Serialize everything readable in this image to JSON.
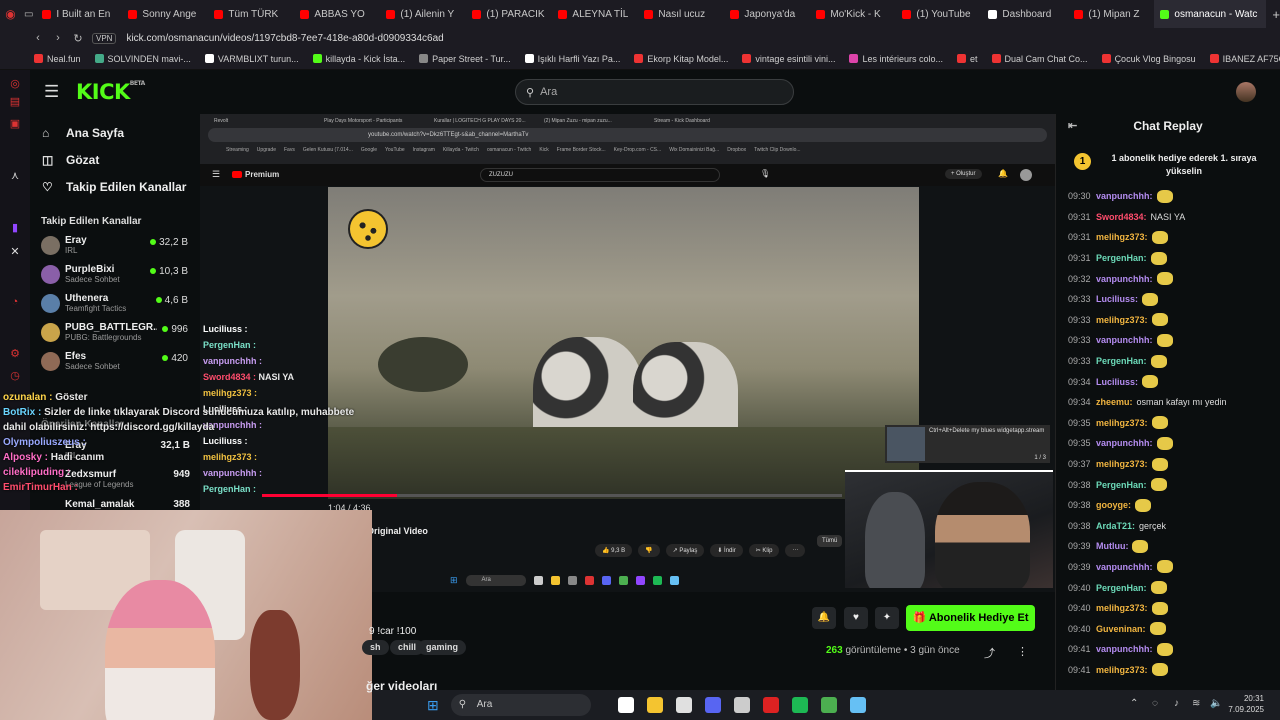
{
  "browser": {
    "tabs": [
      {
        "title": "I Built an En",
        "color": "#ff0000"
      },
      {
        "title": "Sonny Ange",
        "color": "#ff0000"
      },
      {
        "title": "Tüm TÜRK",
        "color": "#ff0000"
      },
      {
        "title": "ABBAS YO",
        "color": "#ff0000"
      },
      {
        "title": "(1) Ailenin Y",
        "color": "#ff0000"
      },
      {
        "title": "(1) PARACIK",
        "color": "#ff0000"
      },
      {
        "title": "ALEYNA TİL",
        "color": "#ff0000"
      },
      {
        "title": "Nasıl ucuz",
        "color": "#ff0000"
      },
      {
        "title": "Japonya'da",
        "color": "#ff0000"
      },
      {
        "title": "Mo'Kick - K",
        "color": "#ff0000"
      },
      {
        "title": "(1) YouTube",
        "color": "#ff0000"
      },
      {
        "title": "Dashboard",
        "color": "#ffffff"
      },
      {
        "title": "(1) Mipan Z",
        "color": "#ff0000"
      },
      {
        "title": "osmanacun - Watc",
        "color": "#53fc18"
      }
    ],
    "url": "kick.com/osmanacun/videos/1197cbd8-7ee7-418e-a80d-d0909334c6ad",
    "vpn_label": "VPN",
    "bookmarks": [
      "Neal.fun",
      "SOLVINDEN mavi-...",
      "VARMBLIXT turun...",
      "killayda - Kick İsta...",
      "Paper Street - Tur...",
      "Işıklı Harfli Yazı Pa...",
      "Ekorp Kitap Model...",
      "vintage esintili vini...",
      "Les intérieurs colo...",
      "et",
      "Dual Cam Chat Co...",
      "Çocuk Vlog Bingosu",
      "IBANEZ AF75G-B..."
    ]
  },
  "kick": {
    "logo": "KICK",
    "logo_badge": "BETA",
    "search_placeholder": "Ara",
    "nav": [
      {
        "label": "Ana Sayfa",
        "icon": "home-icon"
      },
      {
        "label": "Gözat",
        "icon": "browse-icon"
      },
      {
        "label": "Takip Edilen Kanallar",
        "icon": "heart-icon"
      }
    ],
    "followed_title": "Takip Edilen Kanallar",
    "channels": [
      {
        "name": "Eray",
        "category": "IRL",
        "viewers": "32,2 B",
        "color": "#7a6f63"
      },
      {
        "name": "PurpleBixi",
        "category": "Sadece Sohbet",
        "viewers": "10,3 B",
        "color": "#8a5fa8"
      },
      {
        "name": "Uthenera",
        "category": "Teamfight Tactics",
        "viewers": "4,6 B",
        "color": "#5a7fa8"
      },
      {
        "name": "PUBG_BATTLEGR...",
        "category": "PUBG: Battlegrounds",
        "viewers": "996",
        "color": "#c9a44a"
      },
      {
        "name": "Efes",
        "category": "Sadece Sohbet",
        "viewers": "420",
        "color": "#8f6a56"
      }
    ]
  },
  "stream": {
    "inner_tabs": [
      "Revolt",
      "Play Days Motorsport - Participants",
      "Kurallar | LOGITECH G PLAY DAYS 20...",
      "(2) Mipan Zuzu - mipan zuzu...",
      "Stream - Kick Dashboard"
    ],
    "inner_url": "youtube.com/watch?v=Dkz6TTEgt-s&ab_channel=MarthaTv",
    "inner_bookmarks": [
      "Streaming",
      "Upgrade",
      "Favs",
      "Gelen Kutusu (7.014...",
      "Google",
      "YouTube",
      "Instagram",
      "Killayda - Twitch",
      "osmanacun - Twitch",
      "Kick",
      "Frame Border Stock...",
      "Key-Drop.com - CS...",
      "Wix Domaininizi Bağ...",
      "Dropbox",
      "Twitch Clip Downlo..."
    ],
    "yt_logo": "Premium",
    "yt_search": "ZUZUZU",
    "yt_create": "+ Oluştur",
    "timecode": "1:04 / 4:36",
    "progress_fraction": 0.2319,
    "video_title": "Original Video",
    "yt_actions": [
      "👍 9,3 B",
      "👎",
      "↗ Paylaş",
      "⬇ İndir",
      "✂ Klip",
      "···"
    ],
    "tumu": "Tümü",
    "notif_text": "Ctrl+Alt+Delete my blues widgetapp.stream",
    "notif_count": "1 / 3",
    "inner_taskbar_search": "Ara",
    "overlay_chat": [
      {
        "user": "Luciliuss :",
        "color": "#ffffff",
        "msg": ""
      },
      {
        "user": "PergenHan :",
        "color": "#7ae0c8",
        "msg": ""
      },
      {
        "user": "vanpunchhh :",
        "color": "#c79cf0",
        "msg": ""
      },
      {
        "user": "Sword4834 :",
        "color": "#ff4d6d",
        "msg": "NASI YA"
      },
      {
        "user": "melihgz373 :",
        "color": "#f0c040",
        "msg": ""
      },
      {
        "user": "Luciliuss :",
        "color": "#ffffff",
        "msg": ""
      },
      {
        "user": "vanpunchhh :",
        "color": "#c79cf0",
        "msg": ""
      },
      {
        "user": "Luciliuss :",
        "color": "#ffffff",
        "msg": ""
      },
      {
        "user": "melihgz373 :",
        "color": "#f0c040",
        "msg": ""
      },
      {
        "user": "vanpunchhh :",
        "color": "#c79cf0",
        "msg": ""
      },
      {
        "user": "PergenHan :",
        "color": "#7ae0c8",
        "msg": ""
      }
    ]
  },
  "overlay_chat2": [
    {
      "user": "ozunalan :",
      "color": "#ffd54a",
      "msg": "Göster"
    },
    {
      "user": "BotRix :",
      "color": "#6bd5ff",
      "msg": "Sizler de linke tıklayarak Discord sunucumuza katılıp, muhabbete"
    },
    {
      "user": "",
      "color": "#ffffff",
      "msg": "dahil olabilirsiniz: https://discord.gg/killayda"
    },
    {
      "user": "Olympoliuszeus :",
      "color": "#9aa9ff",
      "msg": ""
    },
    {
      "user": "Alposky :",
      "color": "#ff6ec7",
      "msg": "Hadi canım"
    },
    {
      "user": "cileklipuding :",
      "color": "#ff6ec7",
      "msg": ""
    },
    {
      "user": "EmirTimurHan :",
      "color": "#ff4d6d",
      "msg": ""
    }
  ],
  "sidebar_partial": {
    "recommended": "Önerilen Kanallar",
    "ch1": {
      "name": "Eray",
      "cat": "IRL",
      "viewers": "32,1 B"
    },
    "ch2": {
      "name": "Zedxsmurf",
      "cat": "League of Legends",
      "viewers": "949"
    },
    "ch3": {
      "name": "Kemal_amalak",
      "viewers": "388"
    }
  },
  "below": {
    "title_fragment": "9 !car !100",
    "tags": [
      "sh",
      "chill",
      "gaming"
    ],
    "sub_gift_button": "Abonelik Hediye Et",
    "viewers": "263",
    "viewers_label": "görüntüleme",
    "sep": "•",
    "age": "3 gün önce",
    "more_videos": "ğer videoları"
  },
  "chat": {
    "title": "Chat Replay",
    "banner_badge": "1",
    "banner": "1 abonelik hediye ederek 1. sıraya yükselin",
    "messages": [
      {
        "time": "09:30",
        "user": "vanpunchhh:",
        "color": "#b48cf0",
        "msg": "",
        "emote": true
      },
      {
        "time": "09:31",
        "user": "Sword4834:",
        "color": "#ff4d6d",
        "msg": "NASI YA",
        "emote": false
      },
      {
        "time": "09:31",
        "user": "melihgz373:",
        "color": "#f0b440",
        "msg": "",
        "emote": true
      },
      {
        "time": "09:31",
        "user": "PergenHan:",
        "color": "#6cd9b8",
        "msg": "",
        "emote": true
      },
      {
        "time": "09:32",
        "user": "vanpunchhh:",
        "color": "#b48cf0",
        "msg": "",
        "emote": true
      },
      {
        "time": "09:33",
        "user": "Luciliuss:",
        "color": "#b48cf0",
        "msg": "",
        "emote": true
      },
      {
        "time": "09:33",
        "user": "melihgz373:",
        "color": "#f0b440",
        "msg": "",
        "emote": true
      },
      {
        "time": "09:33",
        "user": "vanpunchhh:",
        "color": "#b48cf0",
        "msg": "",
        "emote": true
      },
      {
        "time": "09:33",
        "user": "PergenHan:",
        "color": "#6cd9b8",
        "msg": "",
        "emote": true
      },
      {
        "time": "09:34",
        "user": "Luciliuss:",
        "color": "#b48cf0",
        "msg": "",
        "emote": true
      },
      {
        "time": "09:34",
        "user": "zheemu:",
        "color": "#f0b440",
        "msg": "osman kafayı mı yedin",
        "emote": false
      },
      {
        "time": "09:35",
        "user": "melihgz373:",
        "color": "#f0b440",
        "msg": "",
        "emote": true
      },
      {
        "time": "09:35",
        "user": "vanpunchhh:",
        "color": "#b48cf0",
        "msg": "",
        "emote": true
      },
      {
        "time": "09:37",
        "user": "melihgz373:",
        "color": "#f0b440",
        "msg": "",
        "emote": true
      },
      {
        "time": "09:38",
        "user": "PergenHan:",
        "color": "#6cd9b8",
        "msg": "",
        "emote": true
      },
      {
        "time": "09:38",
        "user": "gooyge:",
        "color": "#f0b440",
        "msg": "",
        "emote": true
      },
      {
        "time": "09:38",
        "user": "ArdaT21:",
        "color": "#6cd9b8",
        "msg": "gerçek",
        "emote": false
      },
      {
        "time": "09:39",
        "user": "Mutluu:",
        "color": "#b48cf0",
        "msg": "",
        "emote": true
      },
      {
        "time": "09:39",
        "user": "vanpunchhh:",
        "color": "#b48cf0",
        "msg": "",
        "emote": true
      },
      {
        "time": "09:40",
        "user": "PergenHan:",
        "color": "#6cd9b8",
        "msg": "",
        "emote": true
      },
      {
        "time": "09:40",
        "user": "melihgz373:",
        "color": "#f0b440",
        "msg": "",
        "emote": true
      },
      {
        "time": "09:40",
        "user": "Guveninan:",
        "color": "#f0b440",
        "msg": "",
        "emote": true
      },
      {
        "time": "09:41",
        "user": "vanpunchhh:",
        "color": "#b48cf0",
        "msg": "",
        "emote": true
      },
      {
        "time": "09:41",
        "user": "melihgz373:",
        "color": "#f0b440",
        "msg": "",
        "emote": true
      }
    ]
  },
  "taskbar": {
    "search": "Ara",
    "time": "20:31",
    "date": "7.09.2025",
    "apps": [
      "#ffffff",
      "#f4c430",
      "#e0e0e0",
      "#5865f2",
      "#cccccc",
      "#d22",
      "#1db954",
      "#4caf50",
      "#66c0f4"
    ]
  }
}
